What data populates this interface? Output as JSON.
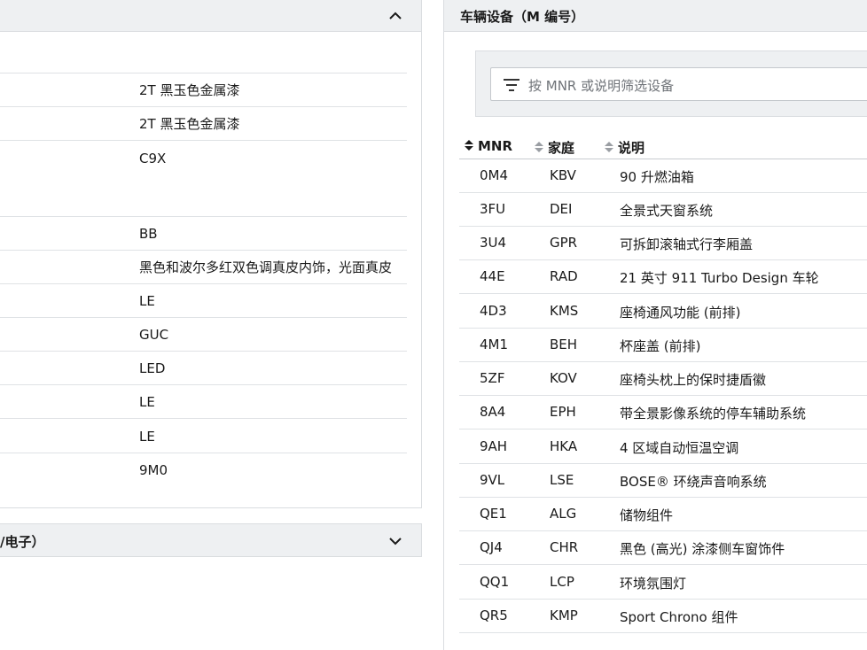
{
  "left_panel": {
    "collapse_icon": "chevron-up-icon",
    "values": [
      "2T 黑玉色金属漆",
      "2T 黑玉色金属漆",
      "C9X",
      "BB",
      "黑色和波尔多红双色调真皮内饰，光面真皮",
      "LE",
      "GUC",
      "LED",
      "LE",
      "LE",
      "9M0"
    ],
    "bottom_section": {
      "title": "/电子）",
      "expand_icon": "chevron-down-icon"
    }
  },
  "right_panel": {
    "title": "车辆设备（M 编号）",
    "filter": {
      "icon": "filter-icon",
      "placeholder": "按 MNR 或说明筛选设备"
    },
    "columns": {
      "mnr": "MNR",
      "family": "家庭",
      "description": "说明"
    },
    "rows": [
      {
        "mnr": "0M4",
        "family": "KBV",
        "description": "90 升燃油箱"
      },
      {
        "mnr": "3FU",
        "family": "DEI",
        "description": "全景式天窗系统"
      },
      {
        "mnr": "3U4",
        "family": "GPR",
        "description": "可拆卸滚轴式行李厢盖"
      },
      {
        "mnr": "44E",
        "family": "RAD",
        "description": "21 英寸 911 Turbo Design 车轮"
      },
      {
        "mnr": "4D3",
        "family": "KMS",
        "description": "座椅通风功能 (前排)"
      },
      {
        "mnr": "4M1",
        "family": "BEH",
        "description": "杯座盖 (前排)"
      },
      {
        "mnr": "5ZF",
        "family": "KOV",
        "description": "座椅头枕上的保时捷盾徽"
      },
      {
        "mnr": "8A4",
        "family": "EPH",
        "description": "带全景影像系统的停车辅助系统"
      },
      {
        "mnr": "9AH",
        "family": "HKA",
        "description": "4 区域自动恒温空调"
      },
      {
        "mnr": "9VL",
        "family": "LSE",
        "description": "BOSE® 环绕声音响系统"
      },
      {
        "mnr": "QE1",
        "family": "ALG",
        "description": "储物组件"
      },
      {
        "mnr": "QJ4",
        "family": "CHR",
        "description": "黑色 (高光) 涂漆侧车窗饰件"
      },
      {
        "mnr": "QQ1",
        "family": "LCP",
        "description": "环境氛围灯"
      },
      {
        "mnr": "QR5",
        "family": "KMP",
        "description": "Sport Chrono 组件"
      }
    ]
  }
}
